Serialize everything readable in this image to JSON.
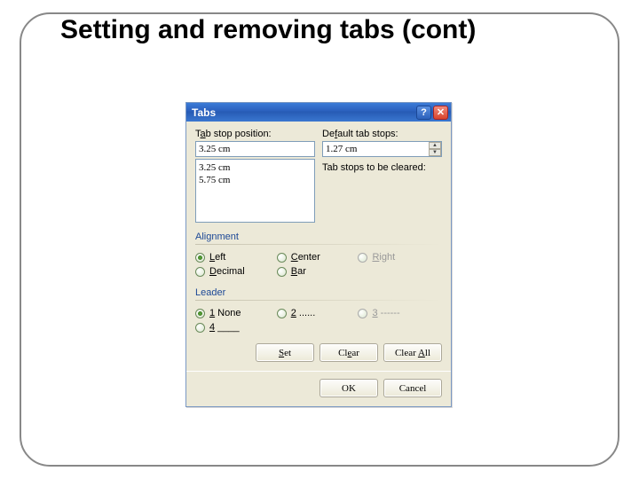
{
  "slide_title": "Setting and removing tabs (cont)",
  "dialog": {
    "title": "Tabs",
    "tabstop_label_pre": "T",
    "tabstop_label_accel": "a",
    "tabstop_label_post": "b stop position:",
    "tabstop_value": "3.25 cm",
    "default_label_pre": "De",
    "default_label_accel": "f",
    "default_label_post": "ault tab stops:",
    "default_value": "1.27 cm",
    "list": [
      "3.25 cm",
      "5.75 cm"
    ],
    "clear_label": "Tab stops to be cleared:",
    "alignment_title": "Alignment",
    "leader_title": "Leader",
    "radios_align": {
      "left_accel": "L",
      "left_post": "eft",
      "center_accel": "C",
      "center_post": "enter",
      "right_accel": "R",
      "right_post": "ight",
      "decimal_accel": "D",
      "decimal_post": "ecimal",
      "bar_accel": "B",
      "bar_post": "ar"
    },
    "radios_leader": {
      "none_accel": "1",
      "none_post": " None",
      "dots_accel": "2",
      "dots_post": " ......",
      "dashes_accel": "3",
      "dashes_post": " ------",
      "under_accel": "4",
      "under_post": " ____"
    },
    "buttons": {
      "set_accel": "S",
      "set_post": "et",
      "clear_pre": "Cl",
      "clear_accel": "e",
      "clear_post": "ar",
      "clearall_pre": "Clear ",
      "clearall_accel": "A",
      "clearall_post": "ll",
      "ok": "OK",
      "cancel": "Cancel"
    }
  }
}
